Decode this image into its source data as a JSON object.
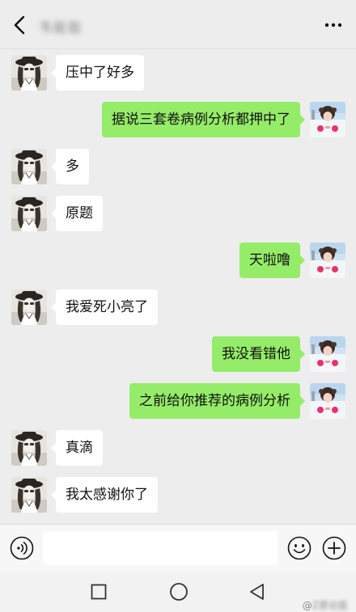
{
  "header": {
    "title": "韦能能",
    "back_icon": "chevron-left-icon",
    "more_icon": "more-dots-icon"
  },
  "messages": [
    {
      "side": "left",
      "text": "压中了好多"
    },
    {
      "side": "right",
      "text": "据说三套卷病例分析都押中了"
    },
    {
      "side": "left",
      "text": "多"
    },
    {
      "side": "left",
      "text": "原题"
    },
    {
      "side": "right",
      "text": "天啦噜"
    },
    {
      "side": "left",
      "text": "我爱死小亮了"
    },
    {
      "side": "right",
      "text": "我没看错他"
    },
    {
      "side": "right",
      "text": "之前给你推荐的病例分析"
    },
    {
      "side": "left",
      "text": "真滴"
    },
    {
      "side": "left",
      "text": "我太感谢你了"
    }
  ],
  "input_bar": {
    "voice_icon": "voice-icon",
    "input_value": "",
    "emoji_icon": "emoji-icon",
    "add_icon": "plus-circle-icon"
  },
  "nav_bar": {
    "recent_icon": "square-icon",
    "home_icon": "circle-icon",
    "back_icon": "triangle-back-icon"
  },
  "watermark": {
    "at": "@",
    "name": "Z君论医"
  },
  "colors": {
    "background": "#ededed",
    "sent_bubble": "#95ec69",
    "received_bubble": "#ffffff"
  }
}
